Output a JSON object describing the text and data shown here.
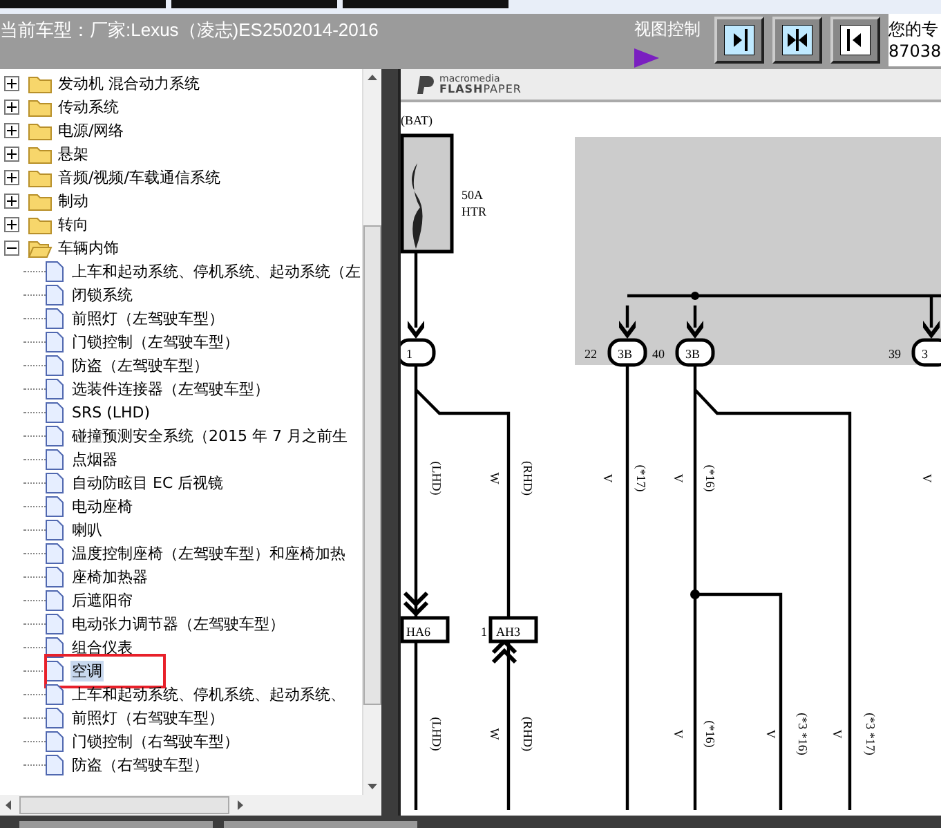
{
  "header": {
    "model": "当前车型：厂家:Lexus（凌志)ES2502014-2016",
    "view_control": "视图控制",
    "side_text": [
      "您的专",
      "87038"
    ]
  },
  "tree": [
    {
      "label": "发动机 混合动力系统",
      "expanded": false
    },
    {
      "label": "传动系统",
      "expanded": false
    },
    {
      "label": "电源/网络",
      "expanded": false
    },
    {
      "label": "悬架",
      "expanded": false
    },
    {
      "label": "音频/视频/车载通信系统",
      "expanded": false
    },
    {
      "label": "制动",
      "expanded": false
    },
    {
      "label": "转向",
      "expanded": false
    },
    {
      "label": "车辆内饰",
      "expanded": true,
      "children": [
        {
          "label": "上车和起动系统、停机系统、起动系统（左",
          "selected": false
        },
        {
          "label": "闭锁系统",
          "selected": false
        },
        {
          "label": "前照灯（左驾驶车型）",
          "selected": false
        },
        {
          "label": "门锁控制（左驾驶车型）",
          "selected": false
        },
        {
          "label": "防盗（左驾驶车型）",
          "selected": false
        },
        {
          "label": "选装件连接器（左驾驶车型）",
          "selected": false
        },
        {
          "label": "SRS (LHD)",
          "selected": false
        },
        {
          "label": "碰撞预测安全系统（2015 年 7 月之前生",
          "selected": false
        },
        {
          "label": "点烟器",
          "selected": false
        },
        {
          "label": "自动防眩目 EC 后视镜",
          "selected": false
        },
        {
          "label": "电动座椅",
          "selected": false
        },
        {
          "label": "喇叭",
          "selected": false
        },
        {
          "label": "温度控制座椅（左驾驶车型）和座椅加热",
          "selected": false
        },
        {
          "label": "座椅加热器",
          "selected": false
        },
        {
          "label": "后遮阳帘",
          "selected": false
        },
        {
          "label": "电动张力调节器（左驾驶车型）",
          "selected": false
        },
        {
          "label": "组合仪表",
          "selected": false
        },
        {
          "label": "空调",
          "selected": true
        },
        {
          "label": "上车和起动系统、停机系统、起动系统、",
          "selected": false
        },
        {
          "label": "前照灯（右驾驶车型）",
          "selected": false
        },
        {
          "label": "门锁控制（右驾驶车型）",
          "selected": false
        },
        {
          "label": "防盗（右驾驶车型）",
          "selected": false
        }
      ]
    }
  ],
  "viewer": {
    "logo_top": "macromedia",
    "logo_bold": "FLASH",
    "logo_rest": "PAPER",
    "diagram": {
      "source": "(BAT)",
      "fuse_rating": "50A",
      "fuse_name": "HTR",
      "pins": [
        {
          "connector": "1"
        },
        {
          "number": "22",
          "connector": "3B"
        },
        {
          "number": "40",
          "connector": "3B"
        },
        {
          "number": "39",
          "connector": "3"
        }
      ],
      "connectors": [
        {
          "name": "HA6"
        },
        {
          "number": "1",
          "name": "AH3"
        }
      ],
      "wire_labels": [
        "(LHD)",
        "W",
        "(RHD)",
        "V",
        "(*17)",
        "V",
        "(*16)",
        "V",
        "(LHD)",
        "W",
        "(RHD)",
        "V",
        "(*16)",
        "V",
        "(*3 *16)",
        "V",
        "(*3 *17)"
      ]
    }
  }
}
